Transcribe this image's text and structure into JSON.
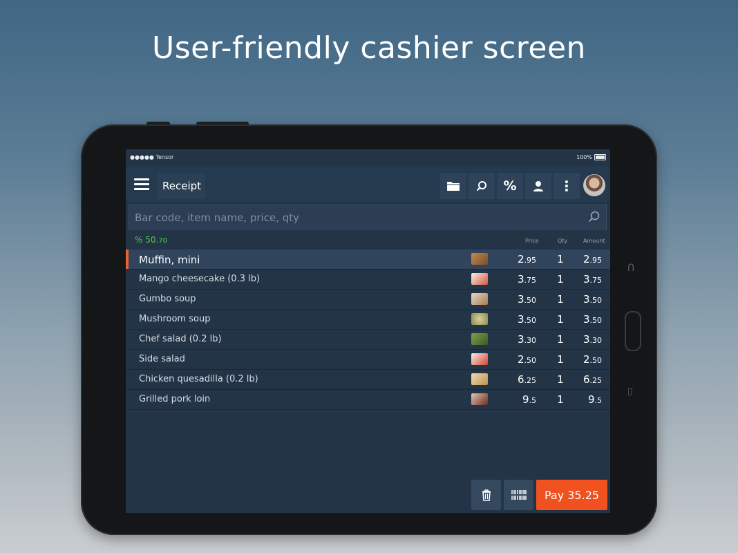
{
  "headline": "User-friendly cashier screen",
  "status": {
    "carrier": "●●●●● Tensor",
    "battery": "100%"
  },
  "topbar": {
    "title": "Receipt",
    "tools": [
      "folder-icon",
      "search-icon",
      "percent-icon",
      "user-icon",
      "more-vert-icon"
    ],
    "percent_label": "%",
    "more_label": "⋮"
  },
  "search": {
    "placeholder": "Bar code, item name, price, qty"
  },
  "columns": {
    "discount_main": "% 50.",
    "discount_sub": "70",
    "price": "Price",
    "qty": "Qty",
    "amount": "Amount"
  },
  "items": [
    {
      "name": "Muffin, mini",
      "price_int": "2",
      "price_dec": ".95",
      "qty": "1",
      "amt_int": "2",
      "amt_dec": ".95",
      "thumb": "#9a6a3a"
    },
    {
      "name": "Mango cheesecake (0.3 lb)",
      "price_int": "3",
      "price_dec": ".75",
      "qty": "1",
      "amt_int": "3",
      "amt_dec": ".75",
      "thumb": "#e8dccd"
    },
    {
      "name": "Gumbo soup",
      "price_int": "3",
      "price_dec": ".50",
      "qty": "1",
      "amt_int": "3",
      "amt_dec": ".50",
      "thumb": "#c9b49a"
    },
    {
      "name": "Mushroom soup",
      "price_int": "3",
      "price_dec": ".50",
      "qty": "1",
      "amt_int": "3",
      "amt_dec": ".50",
      "thumb": "#b6b07a"
    },
    {
      "name": "Chef salad (0.2 lb)",
      "price_int": "3",
      "price_dec": ".30",
      "qty": "1",
      "amt_int": "3",
      "amt_dec": ".30",
      "thumb": "#5b7a3a"
    },
    {
      "name": "Side salad",
      "price_int": "2",
      "price_dec": ".50",
      "qty": "1",
      "amt_int": "2",
      "amt_dec": ".50",
      "thumb": "#d65a4a"
    },
    {
      "name": "Chicken quesadilla (0.2 lb)",
      "price_int": "6",
      "price_dec": ".25",
      "qty": "1",
      "amt_int": "6",
      "amt_dec": ".25",
      "thumb": "#d8b276"
    },
    {
      "name": "Grilled pork loin",
      "price_int": "9",
      "price_dec": ".5",
      "qty": "1",
      "amt_int": "9",
      "amt_dec": ".5",
      "thumb": "#7a3b2a"
    }
  ],
  "footer": {
    "pay_label": "Pay 35.25"
  },
  "colors": {
    "accent": "#e8622f",
    "pay": "#f0511f",
    "discount": "#4ccd4c",
    "screen_bg": "#243447"
  }
}
